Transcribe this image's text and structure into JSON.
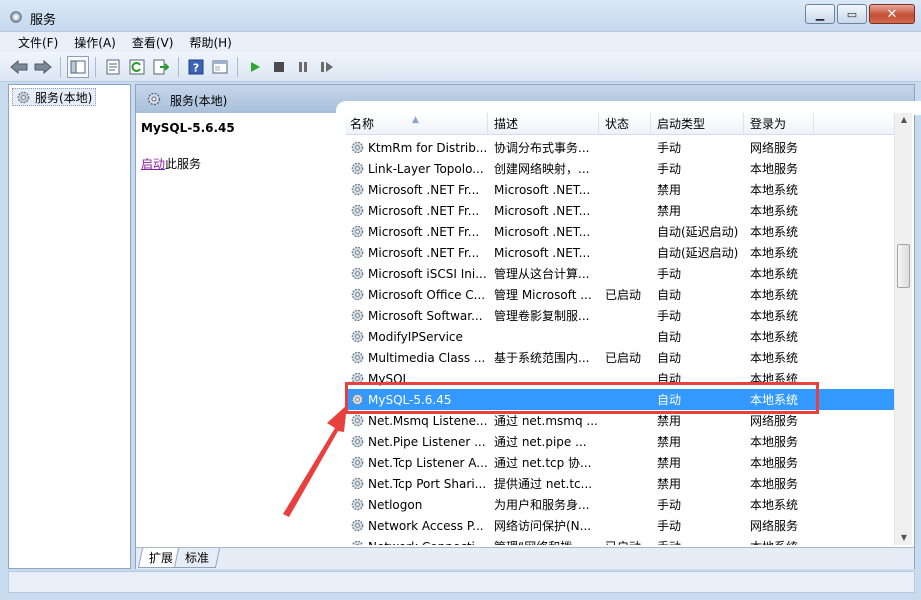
{
  "window": {
    "title": "服务"
  },
  "menu": [
    "文件(F)",
    "操作(A)",
    "查看(V)",
    "帮助(H)"
  ],
  "toolbar": {
    "icons": [
      "back-arrow-icon",
      "forward-arrow-icon",
      "show-hide-tree-icon",
      "properties-icon",
      "refresh-icon",
      "export-icon",
      "help-icon",
      "console-icon",
      "play-icon",
      "stop-icon",
      "pause-icon",
      "restart-icon"
    ]
  },
  "tree": {
    "root_label": "服务(本地)"
  },
  "pane": {
    "header_title": "服务(本地)",
    "selected_service": "MySQL-5.6.45",
    "start_link": "启动",
    "start_suffix": "此服务"
  },
  "columns": [
    "名称",
    "描述",
    "状态",
    "启动类型",
    "登录为"
  ],
  "services": [
    {
      "name": "KtmRm for Distrib...",
      "desc": "协调分布式事务...",
      "status": "",
      "start": "手动",
      "logon": "网络服务"
    },
    {
      "name": "Link-Layer Topolo...",
      "desc": "创建网络映射，...",
      "status": "",
      "start": "手动",
      "logon": "本地服务"
    },
    {
      "name": "Microsoft .NET Fr...",
      "desc": "Microsoft .NET...",
      "status": "",
      "start": "禁用",
      "logon": "本地系统"
    },
    {
      "name": "Microsoft .NET Fr...",
      "desc": "Microsoft .NET...",
      "status": "",
      "start": "禁用",
      "logon": "本地系统"
    },
    {
      "name": "Microsoft .NET Fr...",
      "desc": "Microsoft .NET...",
      "status": "",
      "start": "自动(延迟启动)",
      "logon": "本地系统"
    },
    {
      "name": "Microsoft .NET Fr...",
      "desc": "Microsoft .NET...",
      "status": "",
      "start": "自动(延迟启动)",
      "logon": "本地系统"
    },
    {
      "name": "Microsoft iSCSI Ini...",
      "desc": "管理从这台计算...",
      "status": "",
      "start": "手动",
      "logon": "本地系统"
    },
    {
      "name": "Microsoft Office C...",
      "desc": "管理 Microsoft ...",
      "status": "已启动",
      "start": "自动",
      "logon": "本地系统"
    },
    {
      "name": "Microsoft Softwar...",
      "desc": "管理卷影复制服...",
      "status": "",
      "start": "手动",
      "logon": "本地系统"
    },
    {
      "name": "ModifyIPService",
      "desc": "",
      "status": "",
      "start": "自动",
      "logon": "本地系统"
    },
    {
      "name": "Multimedia Class ...",
      "desc": "基于系统范围内...",
      "status": "已启动",
      "start": "自动",
      "logon": "本地系统"
    },
    {
      "name": "MySQL",
      "desc": "",
      "status": "",
      "start": "自动",
      "logon": "本地系统"
    },
    {
      "name": "MySQL-5.6.45",
      "desc": "",
      "status": "",
      "start": "自动",
      "logon": "本地系统"
    },
    {
      "name": "Net.Msmq Listene...",
      "desc": "通过 net.msmq ...",
      "status": "",
      "start": "禁用",
      "logon": "网络服务"
    },
    {
      "name": "Net.Pipe Listener ...",
      "desc": "通过 net.pipe ...",
      "status": "",
      "start": "禁用",
      "logon": "本地服务"
    },
    {
      "name": "Net.Tcp Listener A...",
      "desc": "通过 net.tcp 协...",
      "status": "",
      "start": "禁用",
      "logon": "本地服务"
    },
    {
      "name": "Net.Tcp Port Shari...",
      "desc": "提供通过 net.tc...",
      "status": "",
      "start": "禁用",
      "logon": "本地服务"
    },
    {
      "name": "Netlogon",
      "desc": "为用户和服务身...",
      "status": "",
      "start": "手动",
      "logon": "本地系统"
    },
    {
      "name": "Network Access P...",
      "desc": "网络访问保护(N...",
      "status": "",
      "start": "手动",
      "logon": "网络服务"
    },
    {
      "name": "Network Connecti...",
      "desc": "管理“网络和拨...",
      "status": "已启动",
      "start": "手动",
      "logon": "本地系统"
    }
  ],
  "selected_index": 12,
  "tabs": [
    "扩展",
    "标准"
  ],
  "colors": {
    "selection": "#3399ff",
    "annotation": "#e8413d"
  }
}
